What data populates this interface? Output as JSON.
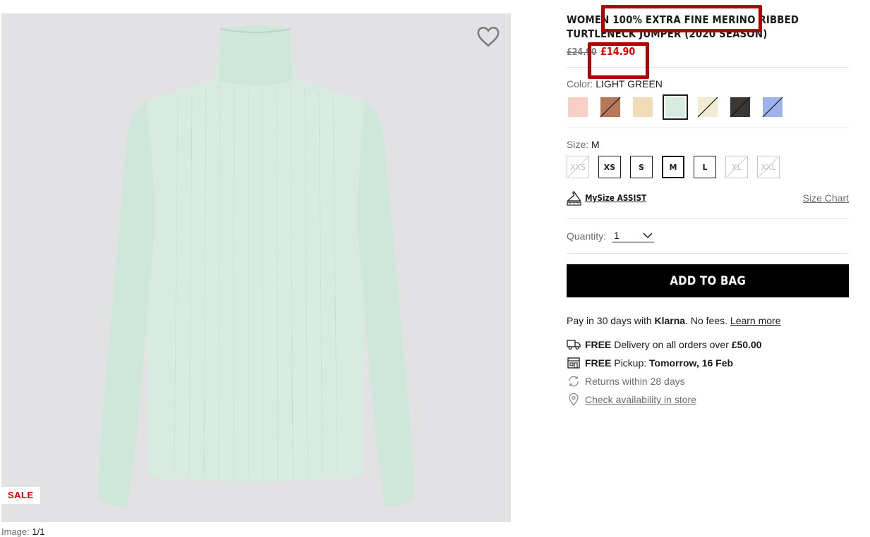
{
  "product": {
    "title": "WOMEN 100% EXTRA FINE MERINO RIBBED TURTLENECK JUMPER (2020 SEASON)",
    "original_price": "£24.90",
    "sale_price": "£14.90",
    "image_bg": "#e2e2e4",
    "sweater_color": "#d7ebe0"
  },
  "gallery": {
    "sale_badge": "SALE",
    "image_counter_label": "Image:",
    "image_counter_value": "1/1",
    "wishlist_icon": "heart-outline-icon"
  },
  "color": {
    "label": "Color:",
    "selected": "LIGHT GREEN",
    "swatches": [
      {
        "name": "pink",
        "hex": "#f8cfc7",
        "available": true
      },
      {
        "name": "brown",
        "hex": "#b9775a",
        "available": false
      },
      {
        "name": "beige",
        "hex": "#f1dcb8",
        "available": true
      },
      {
        "name": "light-green",
        "hex": "#d7ebe0",
        "available": true,
        "selected": true
      },
      {
        "name": "off-white",
        "hex": "#f3ead4",
        "available": false
      },
      {
        "name": "dark-grey",
        "hex": "#3a3836",
        "available": false
      },
      {
        "name": "blue",
        "hex": "#9eb3ec",
        "available": false
      }
    ]
  },
  "size": {
    "label": "Size:",
    "selected": "M",
    "options": [
      {
        "label": "XXS",
        "available": false
      },
      {
        "label": "XS",
        "available": true
      },
      {
        "label": "S",
        "available": true
      },
      {
        "label": "M",
        "available": true,
        "selected": true
      },
      {
        "label": "L",
        "available": true
      },
      {
        "label": "XL",
        "available": false
      },
      {
        "label": "XXL",
        "available": false
      }
    ]
  },
  "mysize": {
    "label": "MySize ASSIST",
    "size_chart": "Size Chart"
  },
  "quantity": {
    "label": "Quantity:",
    "value": "1"
  },
  "cta": {
    "add_to_bag": "ADD TO BAG"
  },
  "klarna": {
    "prefix": "Pay in 30 days with ",
    "brand": "Klarna",
    "suffix": ". No fees. ",
    "link": "Learn more"
  },
  "delivery": {
    "free1": "FREE",
    "delivery_text": " Delivery on all orders over ",
    "delivery_amount": "£50.00",
    "free2": "FREE",
    "pickup_text": " Pickup: ",
    "pickup_date": "Tomorrow, 16 Feb",
    "returns": "Returns within 28 days",
    "store": "Check availability in store"
  },
  "annotation_color": "#b00000"
}
